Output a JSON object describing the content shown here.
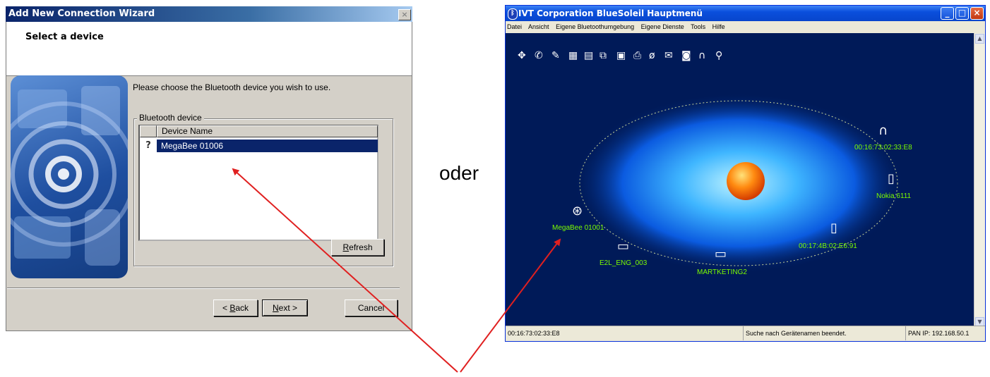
{
  "wizard": {
    "title": "Add New Connection Wizard",
    "heading": "Select a device",
    "prompt": "Please choose the Bluetooth device you wish to use.",
    "group_label": "Bluetooth device",
    "column_header": "Device Name",
    "devices": [
      {
        "name": "MegaBee 01006",
        "selected": true,
        "icon": "unknown-device-icon"
      }
    ],
    "buttons": {
      "refresh": {
        "mnemonic": "R",
        "rest": "efresh"
      },
      "back": {
        "prefix": "< ",
        "mnemonic": "B",
        "rest": "ack"
      },
      "next": {
        "mnemonic": "N",
        "rest": "ext >"
      },
      "cancel": "Cancel"
    }
  },
  "separator_text": "oder",
  "bluesoleil": {
    "title": "IVT Corporation BlueSoleil Hauptmenü",
    "menu": [
      "Datei",
      "Ansicht",
      "Eigene Bluetoothumgebung",
      "Eigene Dienste",
      "Tools",
      "Hilfe"
    ],
    "devices": [
      {
        "label": "00:16:73:02:33:E8",
        "icon": "headset-icon"
      },
      {
        "label": "Nokia 6111",
        "icon": "mobile-phone-icon"
      },
      {
        "label": "00:17:4B:02:E6:91",
        "icon": "mobile-phone-icon"
      },
      {
        "label": "MARTKETING2",
        "icon": "laptop-icon"
      },
      {
        "label": "E2L_ENG_003",
        "icon": "laptop-icon"
      },
      {
        "label": "MegaBee 01001",
        "icon": "unknown-device-icon"
      }
    ],
    "status": {
      "address": "00:16:73:02:33:E8",
      "message": "Suche nach Gerätenamen beendet.",
      "pan_ip": "PAN IP: 192.168.50.1"
    }
  },
  "colors": {
    "device_label": "#7CFC00",
    "canvas_bg": "#001a58",
    "arrow": "#e02020",
    "selection": "#0a246a"
  }
}
